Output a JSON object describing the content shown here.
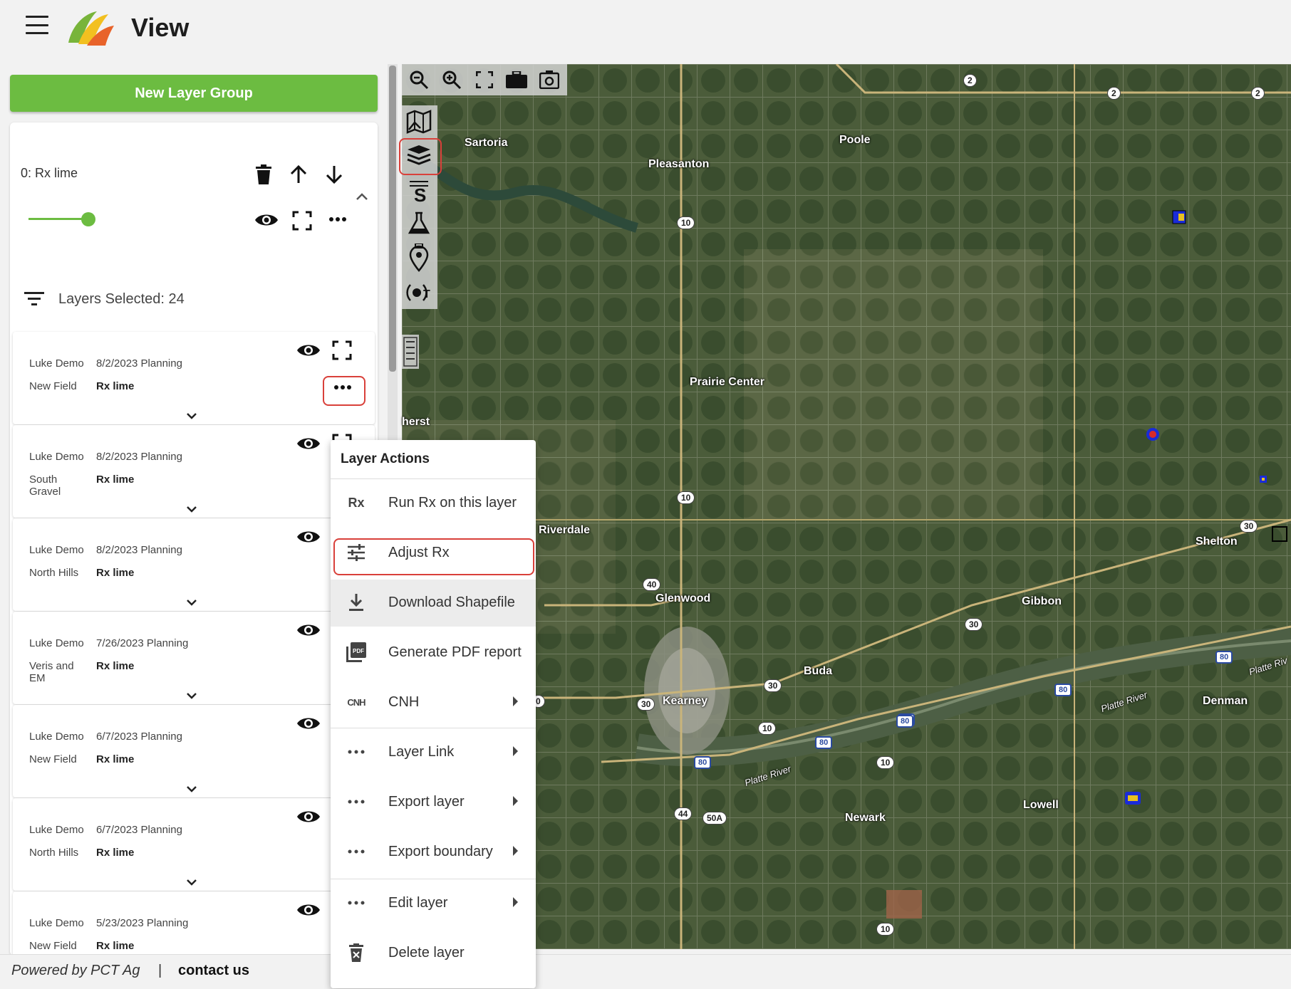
{
  "header": {
    "title": "View"
  },
  "left_panel": {
    "new_group_label": "New Layer Group",
    "group": {
      "label": "0: Rx lime"
    },
    "opacity": 0.84,
    "layers_selected": "Layers Selected: 24",
    "layers": [
      {
        "farm": "Luke Demo",
        "date": "8/2/2023 Planning",
        "field": "New Field",
        "type": "Rx lime"
      },
      {
        "farm": "Luke Demo",
        "date": "8/2/2023 Planning",
        "field": "South Gravel",
        "type": "Rx lime"
      },
      {
        "farm": "Luke Demo",
        "date": "8/2/2023 Planning",
        "field": "North Hills",
        "type": "Rx lime"
      },
      {
        "farm": "Luke Demo",
        "date": "7/26/2023 Planning",
        "field": "Veris and EM",
        "type": "Rx lime"
      },
      {
        "farm": "Luke Demo",
        "date": "6/7/2023 Planning",
        "field": "New Field",
        "type": "Rx lime"
      },
      {
        "farm": "Luke Demo",
        "date": "6/7/2023 Planning",
        "field": "North Hills",
        "type": "Rx lime"
      },
      {
        "farm": "Luke Demo",
        "date": "5/23/2023 Planning",
        "field": "New Field",
        "type": "Rx lime"
      }
    ]
  },
  "context_menu": {
    "title": "Layer Actions",
    "items": [
      {
        "label": "Run Rx on this layer",
        "icon": "rx-icon",
        "icon_text": "Rx"
      },
      {
        "label": "Adjust Rx",
        "icon": "tune-icon"
      },
      {
        "label": "Download Shapefile",
        "icon": "download-icon"
      },
      {
        "label": "Generate PDF report",
        "icon": "pdf-icon"
      },
      {
        "label": "CNH",
        "icon": "cnh-icon",
        "icon_text": "CNH"
      },
      {
        "label": "Layer Link",
        "icon": "more-horiz-icon"
      },
      {
        "label": "Export layer",
        "icon": "more-horiz-icon"
      },
      {
        "label": "Export boundary",
        "icon": "more-horiz-icon"
      },
      {
        "label": "Edit layer",
        "icon": "more-horiz-icon"
      },
      {
        "label": "Delete layer",
        "icon": "delete-icon"
      }
    ]
  },
  "map": {
    "labels": [
      "Sartoria",
      "Pleasanton",
      "Poole",
      "Prairie Center",
      "Riverdale",
      "Glenwood",
      "Gibbon",
      "Shelton",
      "Buda",
      "Kearney",
      "Denman",
      "Newark",
      "Lowell",
      "herst",
      "Platte River",
      "Platte River",
      "Platte Riv"
    ],
    "shields": [
      "2",
      "2",
      "2",
      "10",
      "10",
      "40",
      "30",
      "30",
      "30",
      "30",
      "10",
      "10",
      "44",
      "50A",
      "10",
      "0"
    ],
    "interstate": [
      "80",
      "80",
      "80",
      "80",
      "80",
      "80"
    ]
  },
  "footer": {
    "powered": "Powered by PCT Ag",
    "separator": "|",
    "contact": "contact us"
  }
}
